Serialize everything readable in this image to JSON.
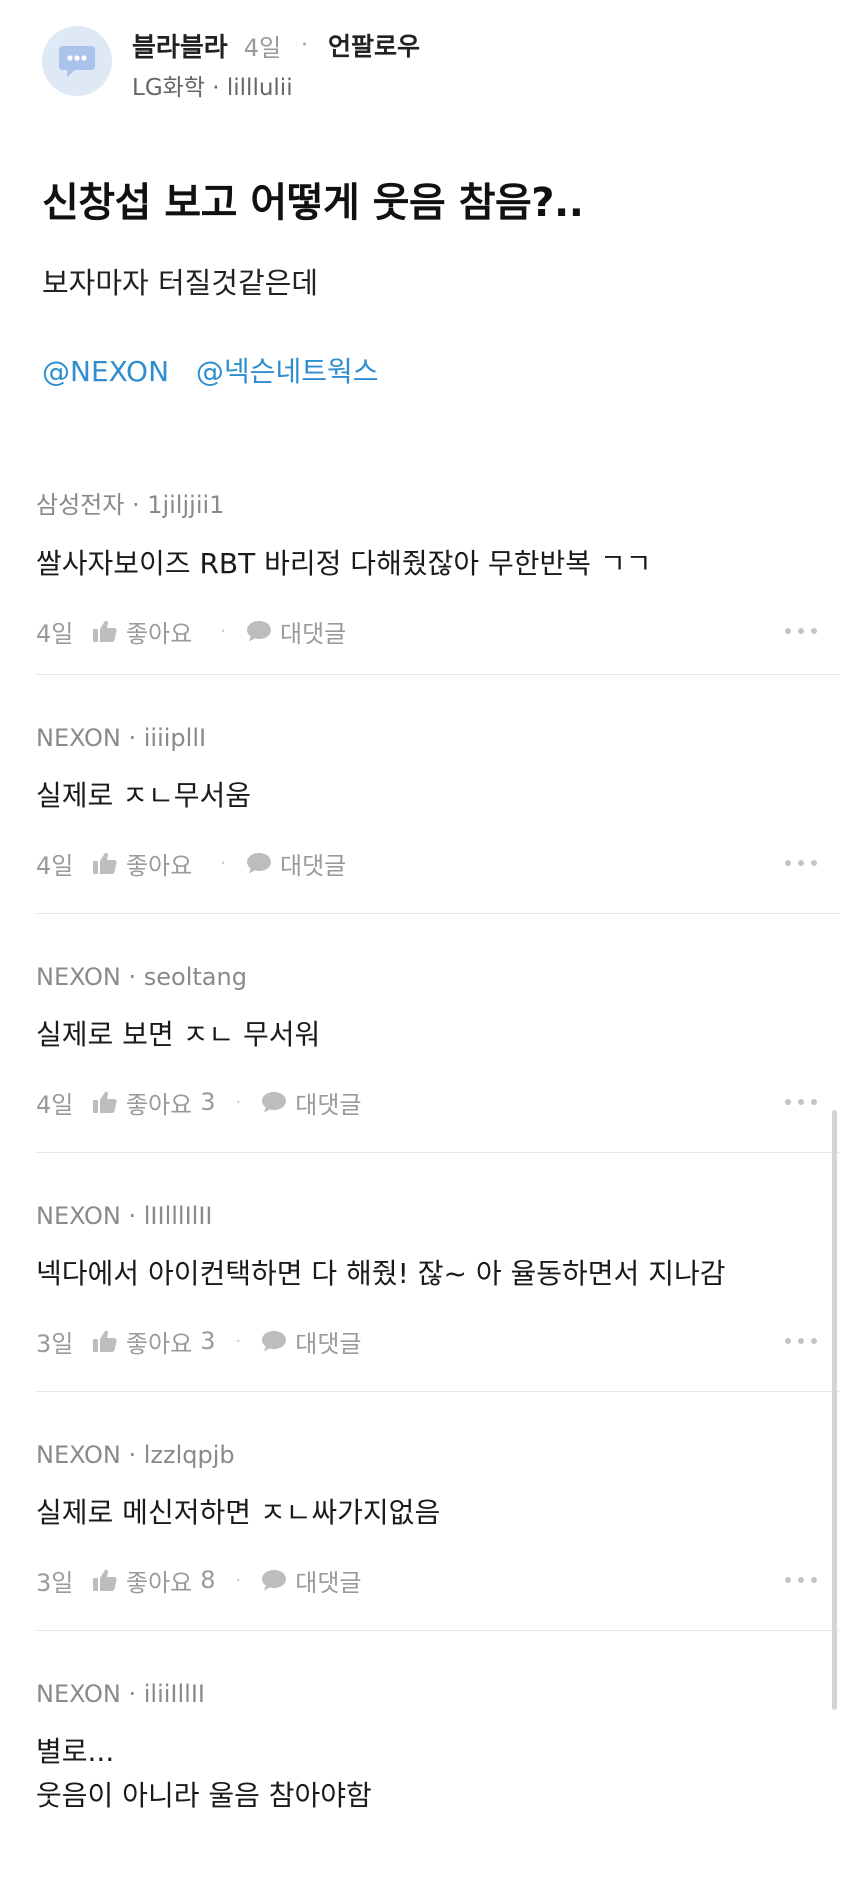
{
  "post": {
    "category": "블라블라",
    "age": "4일",
    "meta_dot": "·",
    "unfollow": "언팔로우",
    "author": "LG화학 · lilllulii",
    "title": "신창섭 보고 어떻게 웃음 참음?..",
    "body": "보자마자 터질것같은데",
    "mentions": [
      "@NEXON",
      "@넥슨네트웍스"
    ]
  },
  "labels": {
    "like": "좋아요",
    "reply": "대댓글",
    "dot": "·"
  },
  "comments": [
    {
      "author": "삼성전자 · 1jiljjii1",
      "lines": [
        "쌀사자보이즈 RBT 바리정 다해줬잖아 무한반복 ㄱㄱ"
      ],
      "age": "4일",
      "likes": ""
    },
    {
      "author": "NEXON · iiiipllI",
      "lines": [
        "실제로 ㅈㄴ무서움"
      ],
      "age": "4일",
      "likes": ""
    },
    {
      "author": "NEXON · seoltang",
      "lines": [
        "실제로 보면 ㅈㄴ 무서워"
      ],
      "age": "4일",
      "likes": "3"
    },
    {
      "author": "NEXON · lIIlllIlII",
      "lines": [
        "넥다에서 아이컨택하면 다 해줬! 잖~ 아 율동하면서 지나감"
      ],
      "age": "3일",
      "likes": "3"
    },
    {
      "author": "NEXON · lzzlqpjb",
      "lines": [
        "실제로 메신저하면 ㅈㄴ싸가지없음"
      ],
      "age": "3일",
      "likes": "8"
    },
    {
      "author": "NEXON · iliiIllII",
      "lines": [
        "별로...",
        "웃음이 아니라 울음 참아야함"
      ],
      "age": "",
      "likes": ""
    }
  ],
  "colors": {
    "mention": "#2f8ed0",
    "muted": "#9a9a9a",
    "avatar_bg": "#dfe8f5",
    "avatar_icon": "#a9c3ea"
  },
  "icons": {
    "avatar": "chat-bubble-icon",
    "like": "thumbs-up-icon",
    "reply": "comment-bubble-icon",
    "more": "more-dots-icon"
  }
}
